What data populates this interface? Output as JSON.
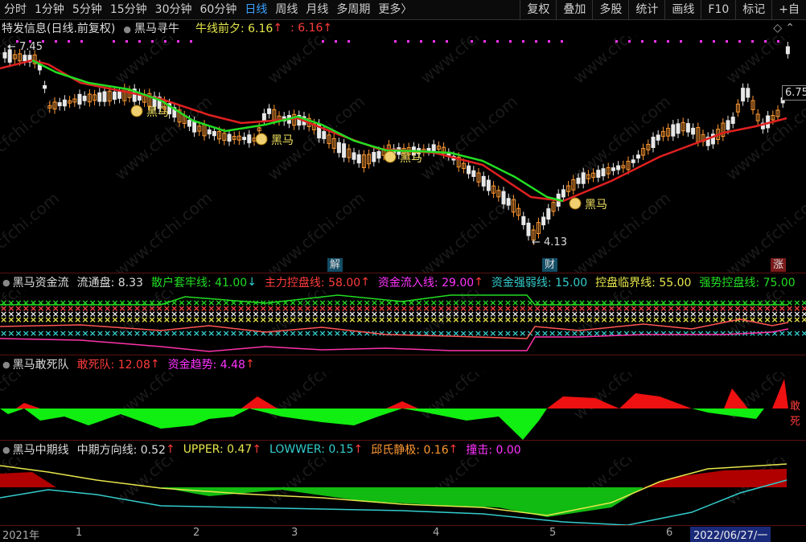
{
  "periods": [
    "分时",
    "1分钟",
    "5分钟",
    "15分钟",
    "30分钟",
    "60分钟",
    "日线",
    "周线",
    "月线",
    "多周期",
    "更多〉"
  ],
  "active_period": "日线",
  "tools": [
    "复权",
    "叠加",
    "多股",
    "统计",
    "画线",
    "F10",
    "标记",
    "+自"
  ],
  "main": {
    "stock": "特发信息(日线.前复权)",
    "indicator": "黑马寻牛",
    "line_label": "牛线前夕: 6.16",
    "line_value2": ": 6.16",
    "high_label": "7.45",
    "low_label": "4.13",
    "right_price": "6.75",
    "tag_label": "黑马",
    "jie": "解",
    "cai": "财",
    "zhang": "涨"
  },
  "panel1": {
    "name": "黑马资金流",
    "float": "流通盘: 8.33",
    "l1": "散户套牢线: 41.00",
    "l2": "主力控盘线: 58.00",
    "l3": "资金流入线: 29.00",
    "l4": "资金强弱线: 15.00",
    "l5": "控盘临界线: 55.00",
    "l6": "强势控盘线: 75.00"
  },
  "panel2": {
    "name": "黑马敢死队",
    "l1": "敢死队: 12.08",
    "l2": "资金趋势: 4.48",
    "right_tag": "敢死"
  },
  "panel3": {
    "name": "黑马中期线",
    "l1": "中期方向线: 0.52",
    "l2": "UPPER: 0.47",
    "l3": "LOWWER: 0.15",
    "l4": "邱氏静极: 0.16",
    "l5": "撞击: 0.00"
  },
  "axis": {
    "year": "2021年",
    "months": [
      "1",
      "2",
      "3",
      "4",
      "5",
      "6"
    ],
    "date": "2022/06/27/一"
  },
  "watermark": "www.cfchi.com",
  "colors": {
    "up": "#ff9933",
    "down": "#e8e8e8",
    "red": "#ff2a2a",
    "green": "#22dd22",
    "cyan": "#33cccc",
    "yellow": "#e6e64c",
    "magenta": "#ff33ff"
  }
}
